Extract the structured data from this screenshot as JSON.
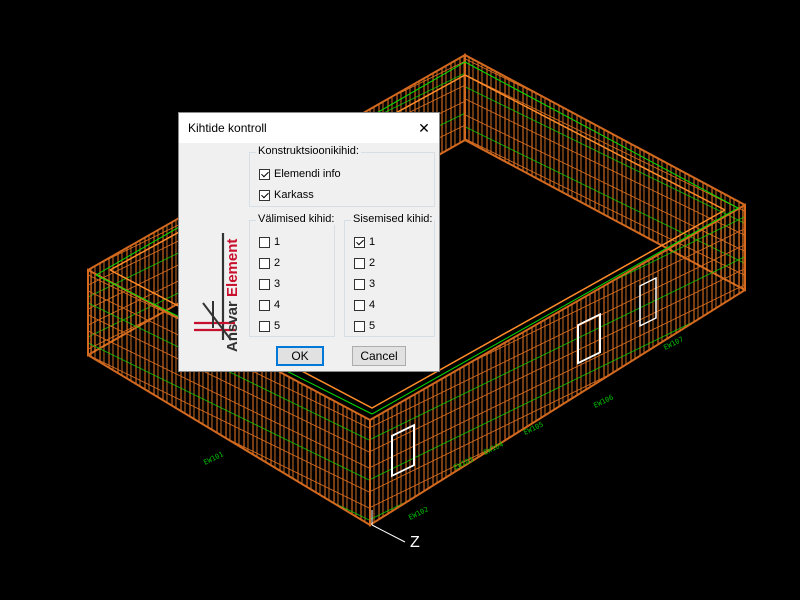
{
  "cad": {
    "axis_label": "Z",
    "element_labels": [
      "EW107",
      "EW106",
      "EW105",
      "EW104",
      "EW103",
      "EW102",
      "EW101"
    ]
  },
  "dialog": {
    "title": "Kihtide kontroll",
    "close_icon": "close-icon",
    "logo_text": "Ansvar Element",
    "construction_group": {
      "label": "Konstruktsioonikihid:",
      "items": [
        {
          "label": "Elemendi info",
          "checked": true
        },
        {
          "label": "Karkass",
          "checked": true
        }
      ]
    },
    "outer_group": {
      "label": "Välimised kihid:",
      "items": [
        {
          "label": "1",
          "checked": false
        },
        {
          "label": "2",
          "checked": false
        },
        {
          "label": "3",
          "checked": false
        },
        {
          "label": "4",
          "checked": false
        },
        {
          "label": "5",
          "checked": false
        }
      ]
    },
    "inner_group": {
      "label": "Sisemised kihid:",
      "items": [
        {
          "label": "1",
          "checked": true
        },
        {
          "label": "2",
          "checked": false
        },
        {
          "label": "3",
          "checked": false
        },
        {
          "label": "4",
          "checked": false
        },
        {
          "label": "5",
          "checked": false
        }
      ]
    },
    "ok_label": "OK",
    "cancel_label": "Cancel"
  },
  "colors": {
    "frame": "#d2691e",
    "frame_light": "#ff8c2a",
    "studs": "#00e000",
    "labels": "#00c000",
    "logo_red": "#c8102e",
    "logo_dark": "#333333",
    "accent": "#0078d7"
  }
}
